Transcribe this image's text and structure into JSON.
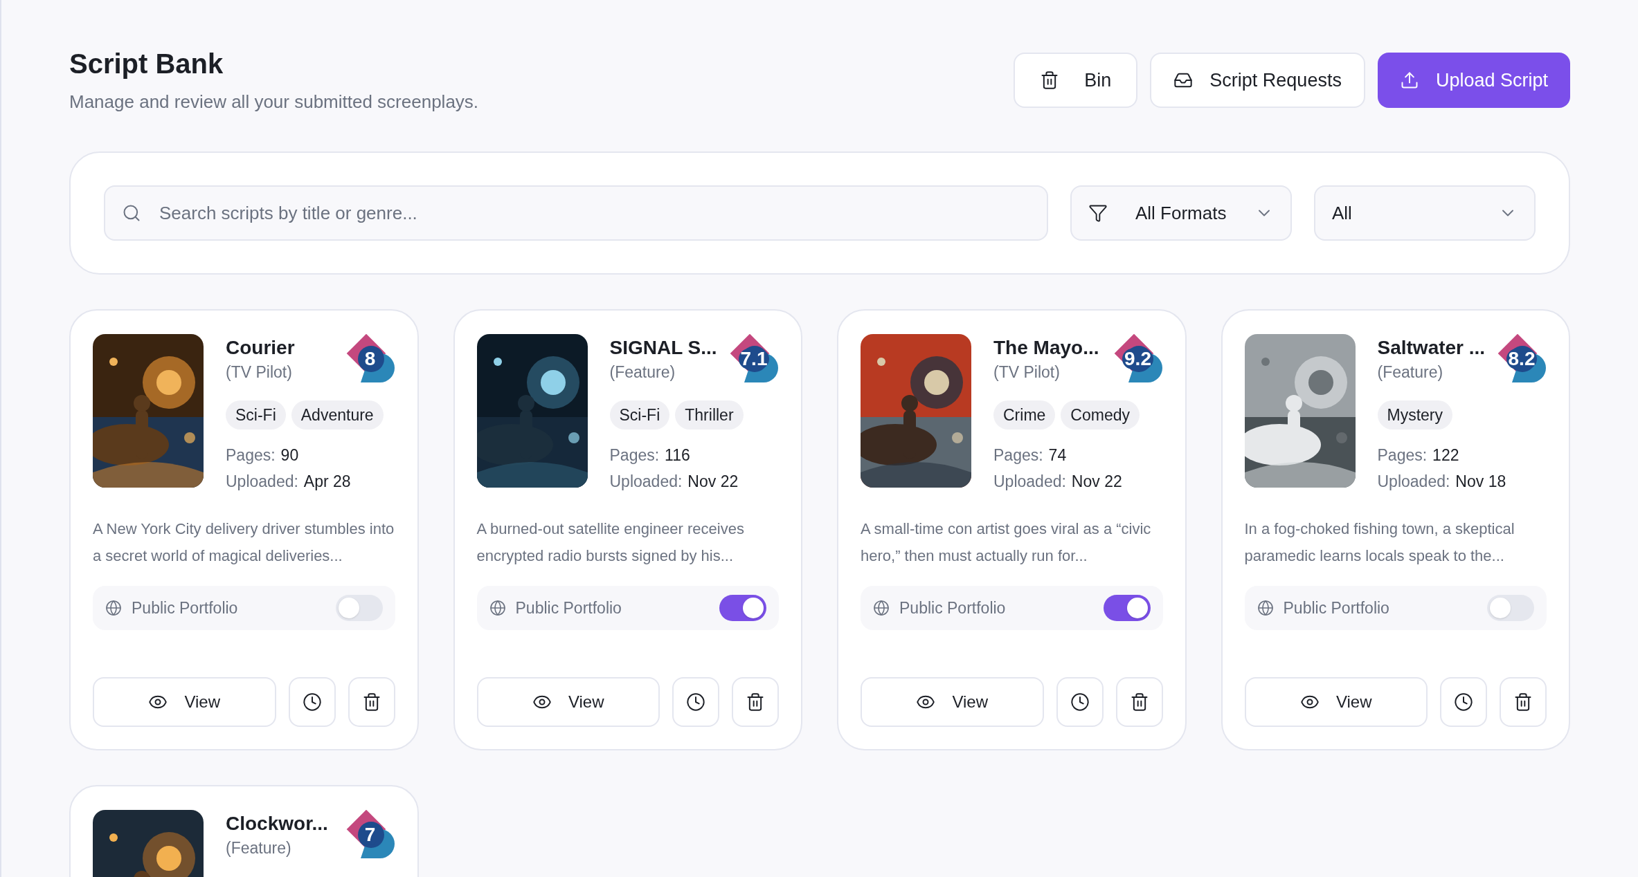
{
  "header": {
    "title": "Script Bank",
    "subtitle": "Manage and review all your submitted screenplays."
  },
  "actions": [
    {
      "kind": "bin",
      "label": "Bin"
    },
    {
      "kind": "requests",
      "label": "Script Requests"
    },
    {
      "kind": "upload",
      "label": "Upload Script"
    }
  ],
  "filters": {
    "search": {
      "placeholder": "Search scripts by title or genre..."
    },
    "format": {
      "value": "All Formats"
    },
    "status": {
      "value": "All"
    }
  },
  "scripts": [
    {
      "title": "Courier",
      "format": "(TV Pilot)",
      "rating": "8",
      "tags": [
        "Sci-Fi",
        "Adventure"
      ],
      "pages_label": "Pages:",
      "pages": "90",
      "uploaded_label": "Uploaded:",
      "uploaded": "Apr 28",
      "description": "A New York City delivery driver stumbles into a secret world of magical deliveries...",
      "portfolio_label": "Public Portfolio",
      "public": false,
      "view_label": "View"
    },
    {
      "title": "SIGNAL S...",
      "format": "(Feature)",
      "rating": "7.1",
      "tags": [
        "Sci-Fi",
        "Thriller"
      ],
      "pages_label": "Pages:",
      "pages": "116",
      "uploaded_label": "Uploaded:",
      "uploaded": "Nov 22",
      "description": "A burned-out satellite engineer receives encrypted radio bursts signed by his...",
      "portfolio_label": "Public Portfolio",
      "public": true,
      "view_label": "View"
    },
    {
      "title": "The Mayo...",
      "format": "(TV Pilot)",
      "rating": "9.2",
      "tags": [
        "Crime",
        "Comedy"
      ],
      "pages_label": "Pages:",
      "pages": "74",
      "uploaded_label": "Uploaded:",
      "uploaded": "Nov 22",
      "description": "A small-time con artist goes viral as a “civic hero,” then must actually run for...",
      "portfolio_label": "Public Portfolio",
      "public": true,
      "view_label": "View"
    },
    {
      "title": "Saltwater ...",
      "format": "(Feature)",
      "rating": "8.2",
      "tags": [
        "Mystery"
      ],
      "pages_label": "Pages:",
      "pages": "122",
      "uploaded_label": "Uploaded:",
      "uploaded": "Nov 18",
      "description": "In a fog-choked fishing town, a skeptical paramedic learns locals speak to the...",
      "portfolio_label": "Public Portfolio",
      "public": false,
      "view_label": "View"
    },
    {
      "title": "Clockwor...",
      "format": "(Feature)",
      "rating": "7"
    }
  ]
}
